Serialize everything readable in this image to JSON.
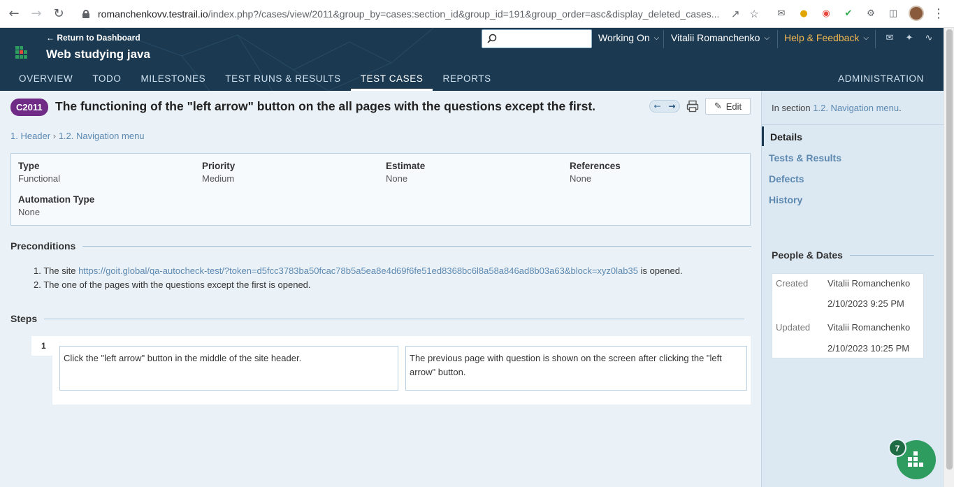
{
  "browser": {
    "url_host": "romanchenkovv.testrail.io",
    "url_rest": "/index.php?/cases/view/2011&group_by=cases:section_id&group_id=191&group_order=asc&display_deleted_cases..."
  },
  "header": {
    "return_link": "← Return to Dashboard",
    "project_title": "Web studying java",
    "working_on": "Working On",
    "user_name": "Vitalii Romanchenko",
    "help": "Help & Feedback",
    "nav_tabs": [
      {
        "label": "OVERVIEW"
      },
      {
        "label": "TODO"
      },
      {
        "label": "MILESTONES"
      },
      {
        "label": "TEST RUNS & RESULTS"
      },
      {
        "label": "TEST CASES"
      },
      {
        "label": "REPORTS"
      }
    ],
    "admin": "ADMINISTRATION"
  },
  "case": {
    "id": "C2011",
    "title": "The functioning of the \"left arrow\" button on the all pages with the questions except the first.",
    "edit_label": "Edit",
    "breadcrumb_1": "1. Header",
    "breadcrumb_sep": "›",
    "breadcrumb_2": "1.2. Navigation menu",
    "props": {
      "type_label": "Type",
      "type_value": "Functional",
      "priority_label": "Priority",
      "priority_value": "Medium",
      "estimate_label": "Estimate",
      "estimate_value": "None",
      "references_label": "References",
      "references_value": "None",
      "automation_label": "Automation Type",
      "automation_value": "None"
    },
    "preconditions_title": "Preconditions",
    "precond_1_pre": "The site ",
    "precond_1_link": "https://goit.global/qa-autocheck-test/?token=d5fcc3783ba50fcac78b5a5ea8e4d69f6fe51ed8368bc6l8a58a846ad8b03a63&block=xyz0lab35",
    "precond_1_post": " is opened.",
    "precond_2": "The one of the pages with the questions except the first is opened.",
    "steps_title": "Steps",
    "steps": [
      {
        "num": "1",
        "action": "Click the \"left arrow\" button in the middle of the site header.",
        "expected": "The previous page with question is shown on the screen after clicking the \"left arrow\" button."
      }
    ]
  },
  "sidebar": {
    "in_section_prefix": "In section ",
    "in_section_link": "1.2. Navigation menu",
    "in_section_suffix": ".",
    "links": [
      {
        "label": "Details"
      },
      {
        "label": "Tests & Results"
      },
      {
        "label": "Defects"
      },
      {
        "label": "History"
      }
    ],
    "people_title": "People & Dates",
    "created_label": "Created",
    "created_by": "Vitalii Romanchenko",
    "created_at": "2/10/2023 9:25 PM",
    "updated_label": "Updated",
    "updated_by": "Vitalii Romanchenko",
    "updated_at": "2/10/2023 10:25 PM"
  },
  "widget": {
    "count": "7"
  },
  "colors": {
    "header_bg": "#1b3a52",
    "badge": "#6f2b85",
    "link": "#5d89b0",
    "help": "#f2b64d",
    "fab": "#2e9b5f"
  }
}
